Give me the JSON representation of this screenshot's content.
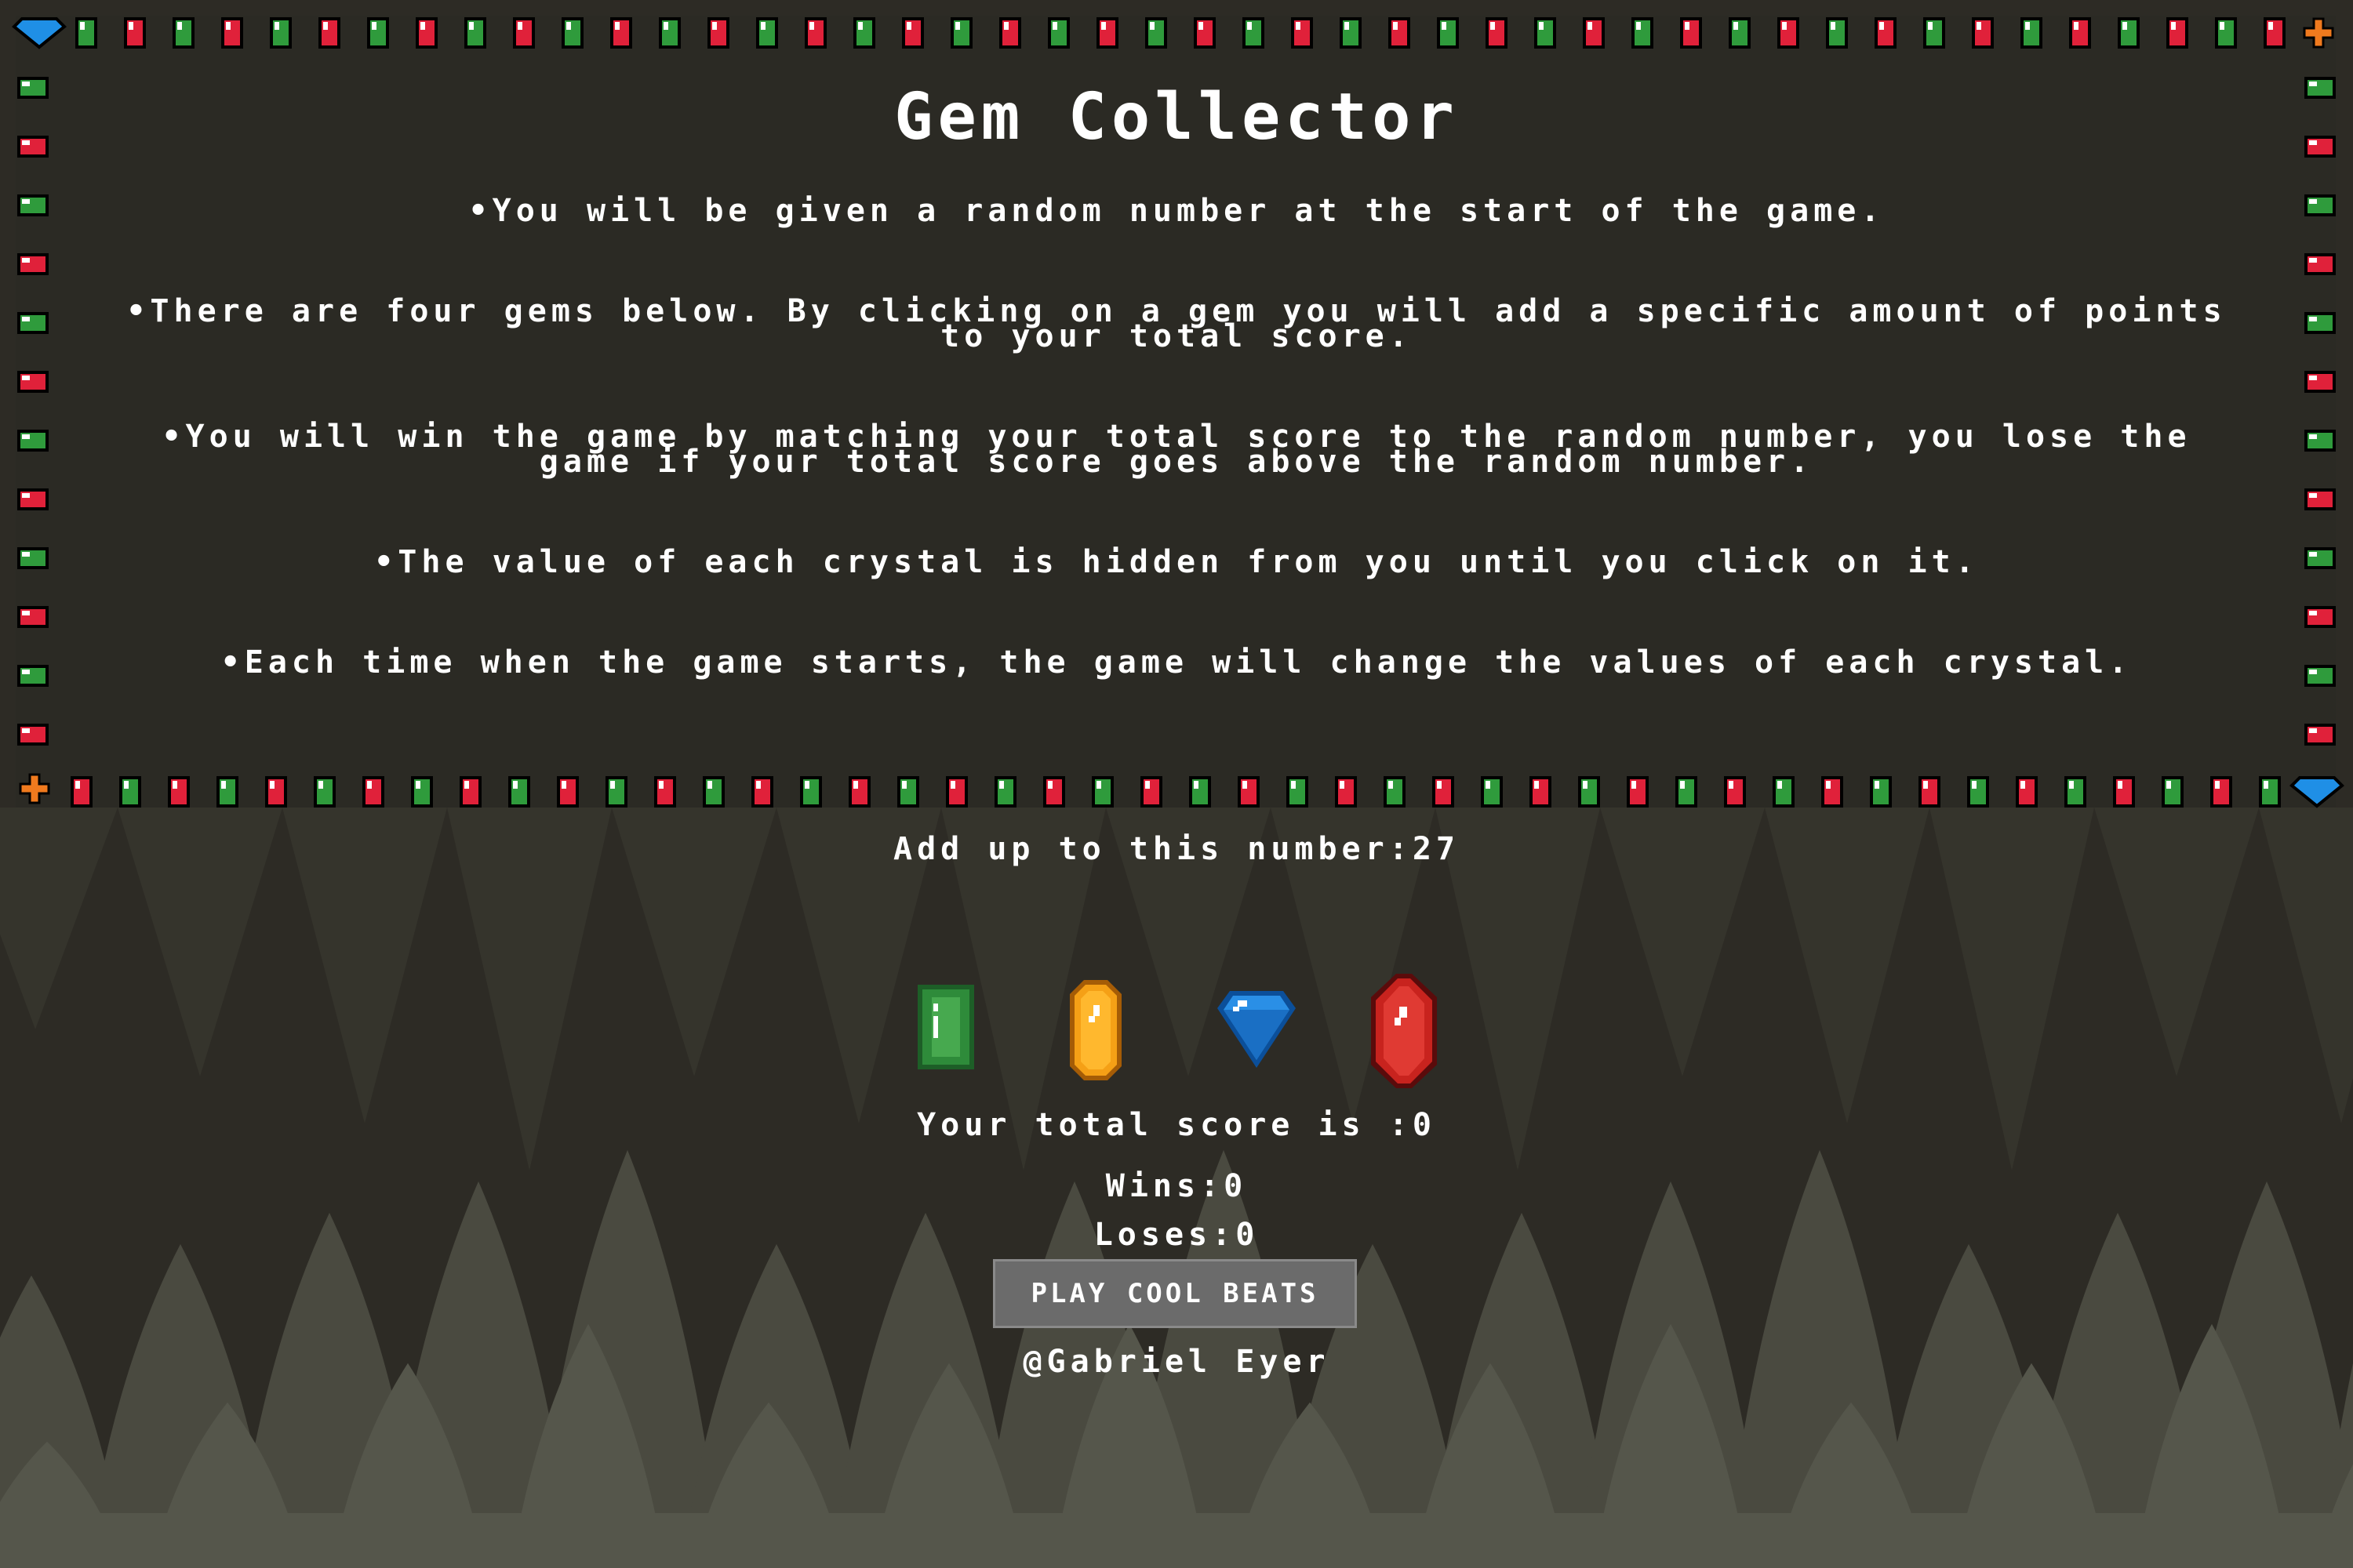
{
  "title": "Gem Collector",
  "rules": [
    "•You will be given a random number at the start of the game.",
    "•There are four gems below. By clicking on a gem you will add a specific amount of points to your total score.",
    "•You will win the game by matching your total score to the random number, you lose the game if your total score goes above the random number.",
    "•The value of each crystal is hidden from you until you click on it.",
    "•Each time when the game starts, the game will change the values of each crystal."
  ],
  "target": {
    "label": "Add up to this number:",
    "value": "27"
  },
  "gems": [
    {
      "name": "green-emerald",
      "color": "#2e8b3a"
    },
    {
      "name": "orange-citrine",
      "color": "#f5a016"
    },
    {
      "name": "blue-diamond",
      "color": "#2a8fe6"
    },
    {
      "name": "red-ruby",
      "color": "#c8231e"
    }
  ],
  "score": {
    "label": "Your total score is :",
    "value": "0"
  },
  "wins": {
    "label": "Wins:",
    "value": "0"
  },
  "loses": {
    "label": "Loses:",
    "value": "0"
  },
  "music_button": "PLAY COOL BEATS",
  "credit": "@Gabriel Eyer",
  "colors": {
    "background": "#2d2b25",
    "border_red": "#e0213a",
    "border_green": "#2f9b3c"
  }
}
